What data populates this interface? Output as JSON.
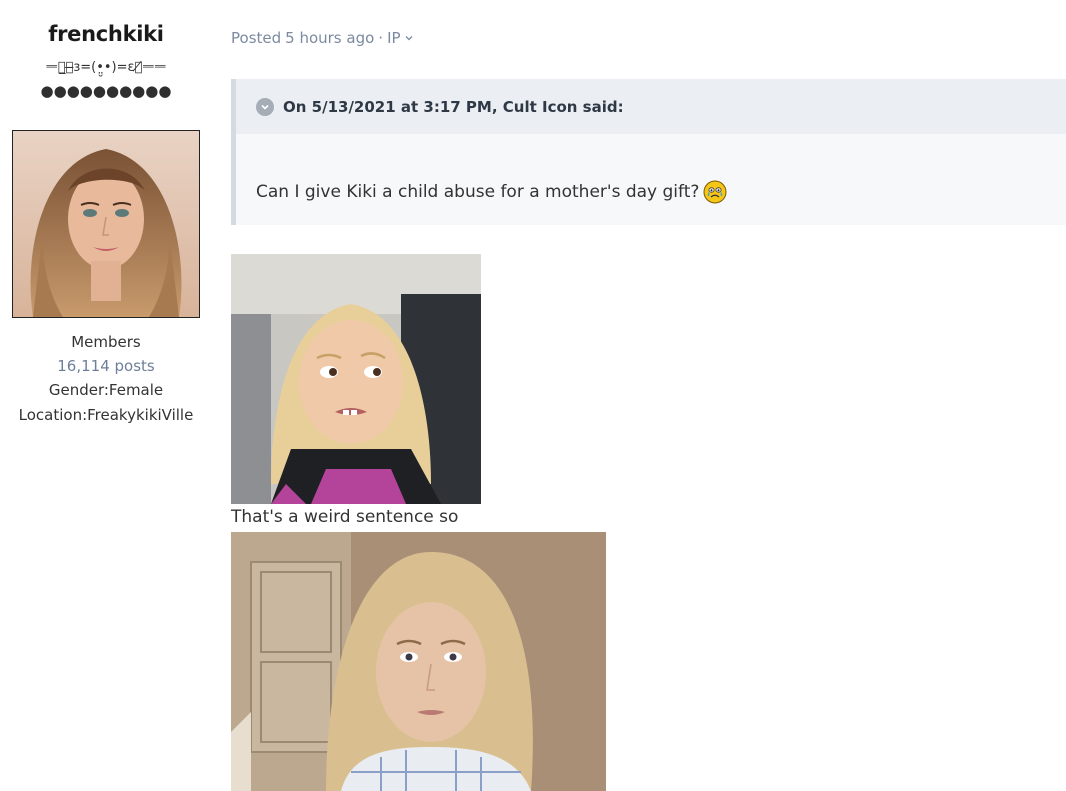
{
  "author": {
    "name": "frenchkiki",
    "title": "ᆖᆖ̲ᢂ̶ɜ=(•̤̮•)=ɛᢂ̸ᆖᆖ",
    "pips": "●●●●●●●●●●",
    "avatar_alt": "avatar",
    "group": "Members",
    "posts": "16,114 posts",
    "gender": "Gender:Female",
    "location": "Location:FreakykikiVille"
  },
  "post": {
    "meta_prefix": "Posted",
    "meta_time": "5 hours ago",
    "meta_sep": "·",
    "meta_ip": "IP",
    "quote": {
      "citation": "On 5/13/2021 at 3:17 PM, Cult Icon said:",
      "text": "Can I give Kiki a child abuse for a mother's day gift?",
      "emoji_icon": "crying-face-icon"
    },
    "reply_text": "That's a weird sentence so"
  },
  "colors": {
    "meta": "#7c8aa0",
    "quote_bg": "#f6f8fa",
    "quote_header_bg": "#ebeff3",
    "quote_border": "#d3dae2",
    "posts_link": "#6e7f99"
  }
}
